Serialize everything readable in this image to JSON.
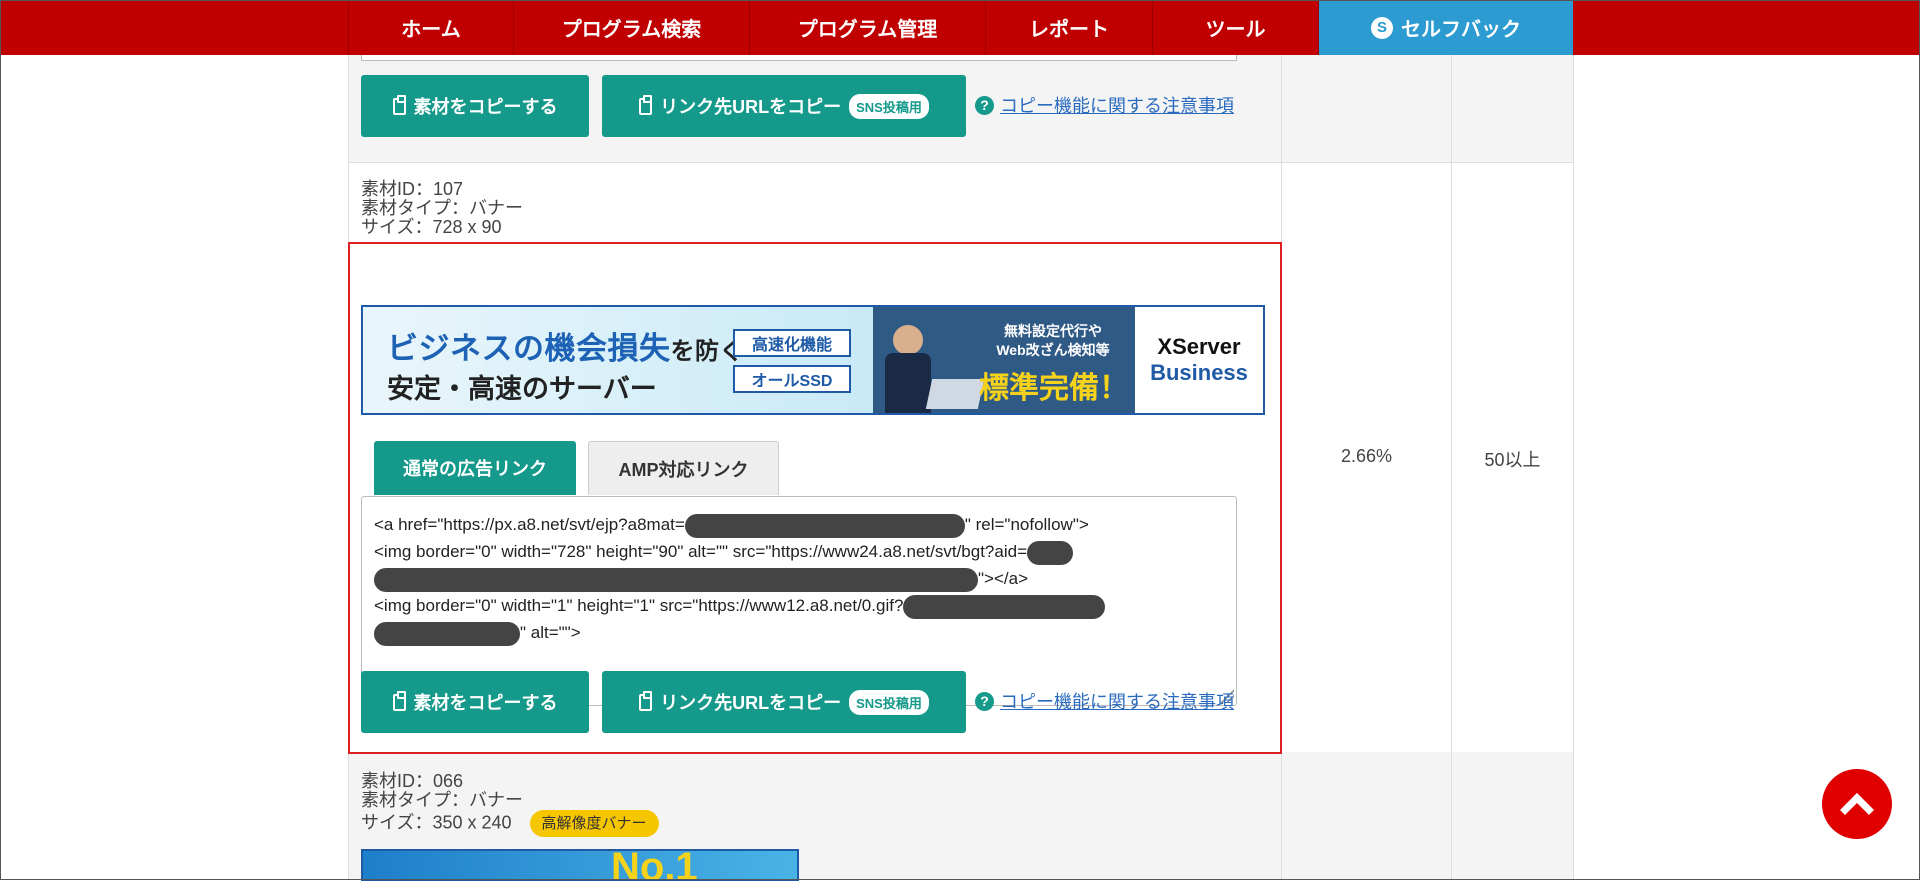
{
  "nav": {
    "items": [
      "ホーム",
      "プログラム検索",
      "プログラム管理",
      "レポート",
      "ツール"
    ],
    "selfback": {
      "icon": "S",
      "label": "セルフバック"
    }
  },
  "buttons": {
    "copy_material": "素材をコピーする",
    "copy_url": "リンク先URLをコピー",
    "sns_badge": "SNS投稿用",
    "note_icon": "?",
    "note_link": "コピー機能に関する注意事項"
  },
  "materials": [
    {
      "id_text": "素材ID：107",
      "type_text": "素材タイプ：バナー",
      "size_text": "サイズ：728 x 90",
      "ctr": "2.66%",
      "count": "50以上",
      "banner": {
        "headline_main": "ビジネスの機会損失",
        "headline_suffix": "を防ぐ",
        "subline": "安定・高速のサーバー",
        "tag1": "高速化機能",
        "tag2": "オールSSD",
        "mid_line1": "無料設定代行や",
        "mid_line2": "Web改ざん検知等",
        "mid_big": "標準完備！",
        "brand1": "XServer",
        "brand2": "Business"
      },
      "tabs": {
        "normal": "通常の広告リンク",
        "amp": "AMP対応リンク"
      },
      "code": {
        "l1_a": "<a href=\"https://px.a8.net/svt/ejp?a8mat=",
        "l1_b": "\" rel=\"nofollow\">",
        "l2_a": "<img border=\"0\" width=\"728\" height=\"90\" alt=\"\" src=\"https://www24.a8.net/svt/bgt?aid=",
        "l3_b": "\"></a>",
        "l4_a": "<img border=\"0\" width=\"1\" height=\"1\" src=\"https://www12.a8.net/0.gif?",
        "l5_b": "\" alt=\"\">"
      }
    },
    {
      "id_text": "素材ID：066",
      "type_text": "素材タイプ：バナー",
      "size_text": "サイズ：350 x 240",
      "badge": "高解像度バナー",
      "banner_text": "No.1"
    }
  ]
}
